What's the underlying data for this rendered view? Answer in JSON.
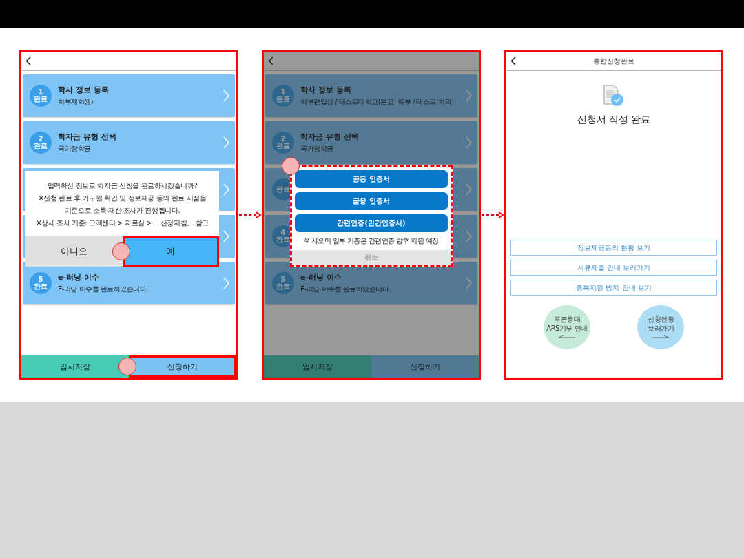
{
  "panels": [
    {
      "kind": "form",
      "dimmed": false,
      "steps": [
        {
          "kind": "step",
          "number": "1",
          "status": "완료",
          "title": "학사 정보 등록",
          "subtitle": "학부재학생)"
        },
        {
          "kind": "step",
          "number": "2",
          "status": "완료",
          "title": "학자금 유형 선택",
          "subtitle": "국가장학금"
        },
        {
          "kind": "covered"
        },
        {
          "kind": "covered"
        },
        {
          "kind": "step",
          "number": "5",
          "status": "완료",
          "title": "e-러닝 이수",
          "subtitle": "E-러닝 이수를 완료하였습니다."
        }
      ],
      "dialog": {
        "kind": "confirm",
        "lines": [
          "입력하신 정보로 학자금 신청을 완료하시겠습니까?",
          "※신청 완료 후 가구원 확인 및 정보제공 동의 완료 시점을",
          "기준으로 소득·재산 조사가 진행됩니다.",
          "※상세 조사 기준: 고객센터 > 자료실 > 「산정지침」 참고"
        ],
        "buttons": [
          {
            "label": "아니오",
            "kind": "secondary",
            "highlighted": false,
            "marker": false
          },
          {
            "label": "예",
            "kind": "primary",
            "highlighted": true,
            "marker": true
          }
        ]
      },
      "footer": [
        {
          "label": "임시저장",
          "kind": "save",
          "highlighted": false,
          "marker": false
        },
        {
          "label": "신청하기",
          "kind": "submit",
          "highlighted": true,
          "marker": true
        }
      ]
    },
    {
      "kind": "form",
      "dimmed": true,
      "steps": [
        {
          "kind": "step",
          "number": "1",
          "status": "완료",
          "title": "학사 정보 등록",
          "subtitle": "학부편입생 / 테스트대학교(본교) 학부 / 테스트(학과)"
        },
        {
          "kind": "step",
          "number": "2",
          "status": "완료",
          "title": "학자금 유형 선택",
          "subtitle": "국가장학금"
        },
        {
          "kind": "step",
          "status": "완료"
        },
        {
          "kind": "step",
          "number": "4",
          "status": "완료"
        },
        {
          "kind": "step",
          "number": "5",
          "status": "완료",
          "title": "e-러닝 이수",
          "subtitle": "E-러닝 이수를 완료하였습니다."
        }
      ],
      "dialog": {
        "kind": "certificate",
        "marker": true,
        "buttons": [
          {
            "label": "공동 인증서",
            "kind": "primary"
          },
          {
            "label": "금융 인증서",
            "kind": "primary"
          },
          {
            "label": "간편인증(민간인증서)",
            "kind": "primary"
          }
        ],
        "note": "※ 샤오미 일부 기종은 간편인증 향후 지원 예정",
        "cancel": "취소"
      },
      "footer": [
        {
          "label": "임시저장",
          "kind": "save",
          "highlighted": false,
          "marker": false
        },
        {
          "label": "신청하기",
          "kind": "submit",
          "highlighted": false,
          "marker": false
        }
      ]
    },
    {
      "kind": "complete",
      "title": "통합신청완료",
      "heading": "신청서 작성 완료",
      "links": [
        "정보제공동의 현황 보기",
        "서류제출 안내 보러가기",
        "중복지원 방지 안내 보기"
      ],
      "circles": [
        {
          "lines": [
            "푸른등대",
            "ARS기부 안내"
          ],
          "color": "#c5ead9",
          "kind": "back"
        },
        {
          "lines": [
            "신청현황",
            "보러가기"
          ],
          "color": "#addcf5",
          "kind": "forward"
        }
      ]
    }
  ]
}
